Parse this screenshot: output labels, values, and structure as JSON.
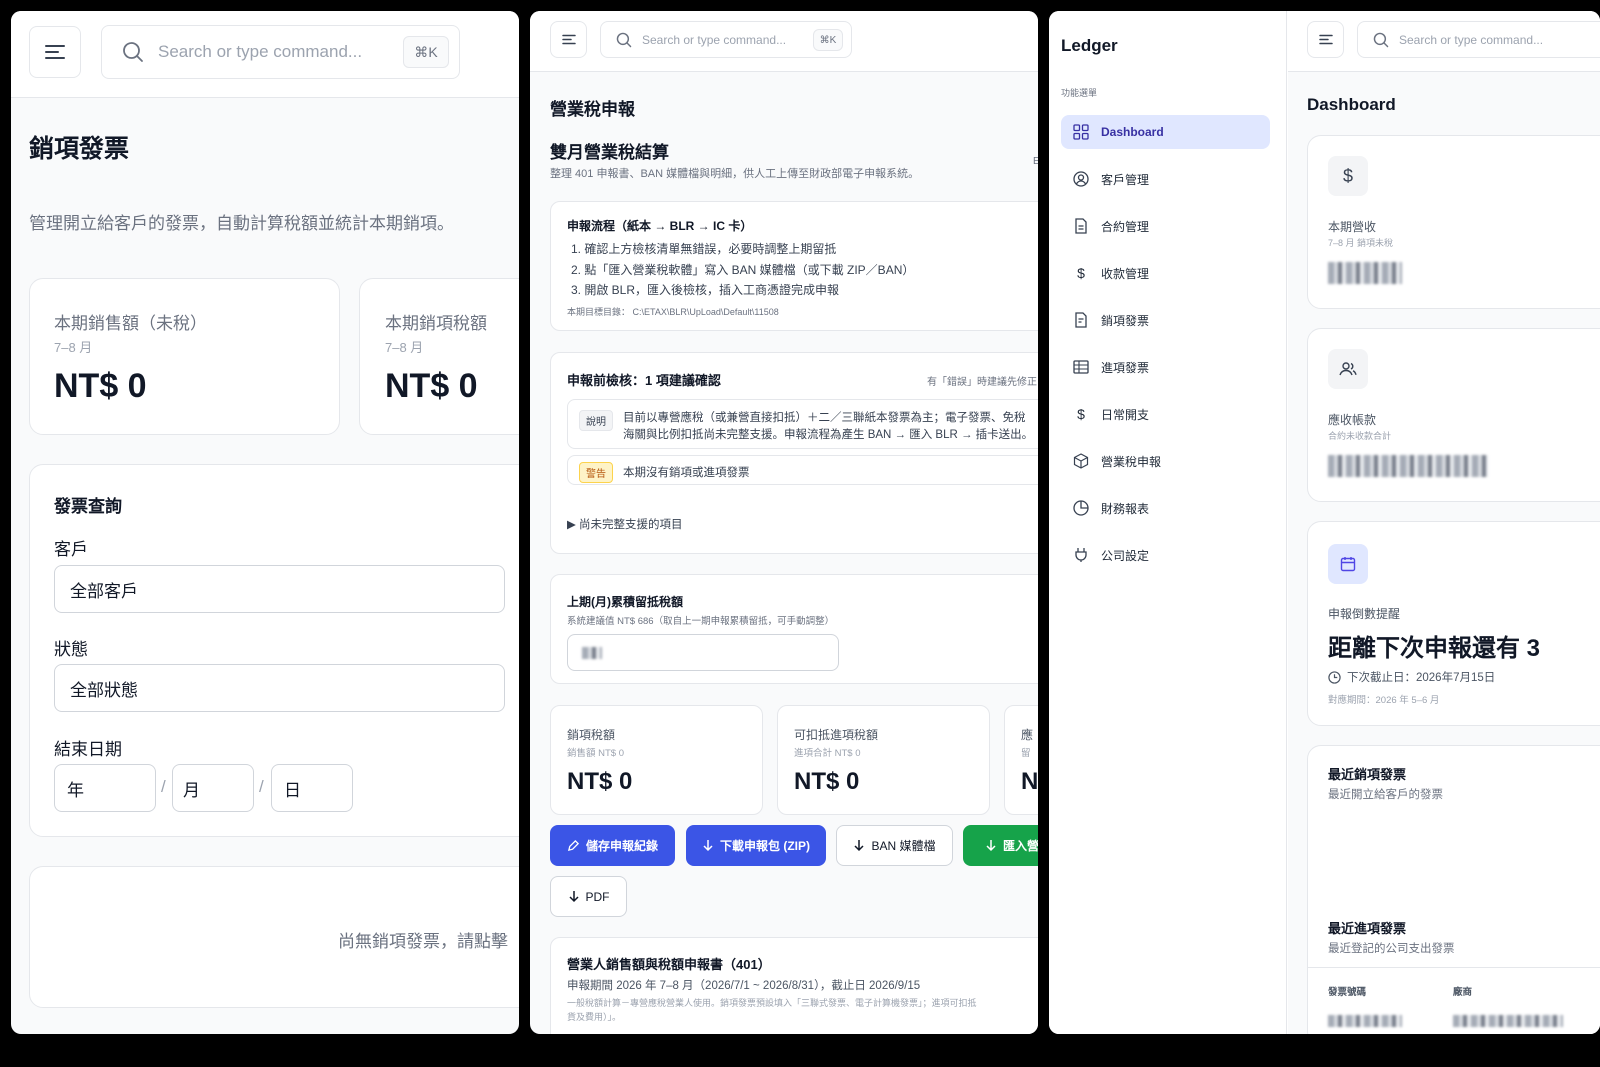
{
  "search": {
    "placeholder": "Search or type command...",
    "shortcut": "⌘K"
  },
  "panel1": {
    "page_title": "銷項發票",
    "description": "管理開立給客戶的發票，自動計算稅額並統計本期銷項。",
    "stats": [
      {
        "label": "本期銷售額（未稅）",
        "period": "7–8 月",
        "value": "NT$ 0"
      },
      {
        "label": "本期銷項稅額",
        "period": "7–8 月",
        "value": "NT$ 0"
      }
    ],
    "filter": {
      "title": "發票查詢",
      "customer_label": "客戶",
      "customer_value": "全部客戶",
      "status_label": "狀態",
      "status_value": "全部狀態",
      "end_date_label": "結束日期",
      "year_placeholder": "年",
      "month_placeholder": "月",
      "day_placeholder": "日",
      "sep": "/"
    },
    "empty_text": "尚無銷項發票，請點擊「"
  },
  "panel2": {
    "header": "營業稅申報",
    "section_title": "雙月營業稅結算",
    "section_desc": "整理 401 申報書、BAN 媒體檔與明細，供人工上傳至財政部電子申報系統。",
    "side_letter": "E",
    "process": {
      "title": "申報流程（紙本 → BLR → IC 卡）",
      "steps": [
        "1. 確認上方檢核清單無錯誤，必要時調整上期留抵",
        "2. 點「匯入營業稅軟體」寫入 BAN 媒體檔（或下載 ZIP／BAN）",
        "3. 開啟 BLR，匯入後檢核，插入工商憑證完成申報"
      ],
      "target_dir": "本期目標目錄：  C:\\ETAX\\BLR\\UpLoad\\Default\\11508"
    },
    "check": {
      "title": "申報前檢核：1 項建議確認",
      "hint": "有「錯誤」時建議先修正",
      "note_tag": "說明",
      "note_text_1": "目前以專營應稅（或兼營直接扣抵）＋二／三聯紙本發票為主；電子發票、免稅",
      "note_text_2": "海關與比例扣抵尚未完整支援。申報流程為產生 BAN → 匯入 BLR → 插卡送出。",
      "warn_tag": "警告",
      "warn_text": "本期沒有銷項或進項發票",
      "unsupported": "▶ 尚未完整支援的項目"
    },
    "carry": {
      "title": "上期(月)累積留抵稅額",
      "desc": "系統建議值 NT$ 686（取自上一期申報累積留抵，可手動調整）"
    },
    "stats": [
      {
        "label": "銷項稅額",
        "sub": "銷售額 NT$ 0",
        "value": "NT$ 0"
      },
      {
        "label": "可扣抵進項稅額",
        "sub": "進項合計 NT$ 0",
        "value": "NT$ 0"
      },
      {
        "label": "應",
        "sub": "留",
        "value": "N"
      }
    ],
    "buttons": {
      "save": "儲存申報紀錄",
      "download_zip": "下載申報包 (ZIP)",
      "ban": "BAN 媒體檔",
      "import": "匯入營",
      "pdf": "PDF"
    },
    "form401": {
      "title": "營業人銷售額與稅額申報書（401）",
      "period": "申報期間 2026 年 7–8 月（2026/7/1 ~ 2026/8/31），截止日 2026/9/15",
      "desc_1": "一般稅額計算－專營應稅營業人使用。銷項發票預設填入「三聯式發票、電子計算機發票」；進項可扣抵",
      "desc_2": "貨及費用）」。"
    }
  },
  "panel3": {
    "app_name": "Ledger",
    "menu_heading": "功能選單",
    "nav": [
      {
        "label": "Dashboard",
        "icon": "grid-icon"
      },
      {
        "label": "客戶管理",
        "icon": "user-circle-icon"
      },
      {
        "label": "合約管理",
        "icon": "document-icon"
      },
      {
        "label": "收款管理",
        "icon": "dollar-icon"
      },
      {
        "label": "銷項發票",
        "icon": "receipt-icon"
      },
      {
        "label": "進項發票",
        "icon": "table-icon"
      },
      {
        "label": "日常開支",
        "icon": "dollar-icon"
      },
      {
        "label": "營業稅申報",
        "icon": "box-icon"
      },
      {
        "label": "財務報表",
        "icon": "pie-chart-icon"
      },
      {
        "label": "公司設定",
        "icon": "plug-icon"
      }
    ],
    "dashboard_title": "Dashboard",
    "revenue": {
      "label": "本期營收",
      "sub": "7–8 月 銷項未稅"
    },
    "receivable": {
      "label": "應收帳款",
      "sub": "合約未收款合計"
    },
    "reminder": {
      "label": "申報倒數提醒",
      "headline": "距離下次申報還有 3",
      "next_deadline": "下次截止日：2026年7月15日",
      "period": "對應期間：2026 年 5–6 月"
    },
    "recent_sales": {
      "title": "最近銷項發票",
      "desc": "最近開立給客戶的發票"
    },
    "recent_purchase": {
      "title": "最近進項發票",
      "desc": "最近登記的公司支出發票",
      "col_invoice": "發票號碼",
      "col_vendor": "廠商"
    }
  },
  "colors": {
    "accent": "#4f46e5",
    "primary_button": "#3b55e6",
    "green_button": "#16a34a",
    "active_nav_bg": "#e0e7ff",
    "warn_tag_bg": "#fef3c7"
  }
}
